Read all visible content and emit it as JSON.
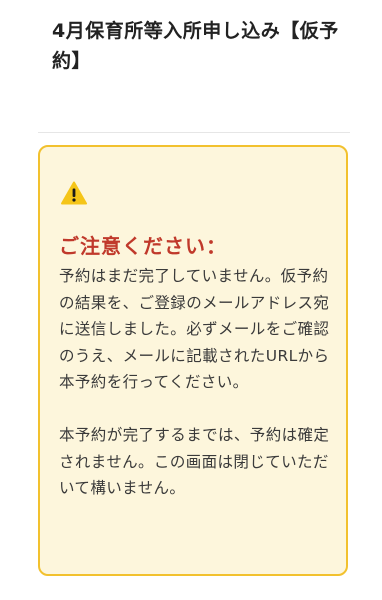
{
  "header": {
    "title": "4月保育所等入所申し込み【仮予約】"
  },
  "notice": {
    "icon": "warning-icon",
    "heading": "ご注意ください：",
    "paragraph1": "予約はまだ完了していません。仮予約の結果を、ご登録のメールアドレス宛に送信しました。必ずメールをご確認のうえ、メールに記載されたURLから本予約を行ってください。",
    "paragraph2": "本予約が完了するまでは、予約は確定されません。この画面は閉じていただいて構いません。",
    "colors": {
      "background": "#fdf6dc",
      "border": "#f2c12e",
      "heading": "#c0392b",
      "icon": "#f5c518"
    }
  }
}
